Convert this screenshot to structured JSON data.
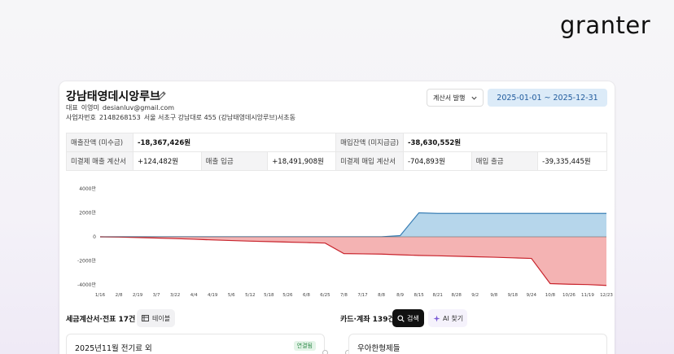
{
  "brand": {
    "logo_text": "granter"
  },
  "company": {
    "name": "강남태영데시앙루브",
    "representative_label": "대표",
    "representative": "이영미",
    "email": "desianluv@gmail.com",
    "biz_no_label": "사업자번호",
    "biz_no": "2148268153",
    "address": "서울 서초구 강남대로 455 (강남태영데시앙루브)서초동"
  },
  "toolbar": {
    "issue_label": "계산서 발행",
    "date_range": "2025-01-01 ~ 2025-12-31"
  },
  "summary": {
    "receivable_label": "매출잔액 (미수금)",
    "receivable_value": "-18,367,426원",
    "payable_label": "매입잔액 (미지급금)",
    "payable_value": "-38,630,552원",
    "unpaid_sales_invoice_label": "미결제 매출 계산서",
    "unpaid_sales_invoice_value": "+124,482원",
    "sales_deposit_label": "매출 입금",
    "sales_deposit_value": "+18,491,908원",
    "unpaid_purchase_invoice_label": "미결제 매입 계산서",
    "unpaid_purchase_invoice_value": "-704,893원",
    "purchase_withdrawal_label": "매입 출금",
    "purchase_withdrawal_value": "-39,335,445원"
  },
  "chart_data": {
    "type": "area",
    "ylim": [
      -4000,
      4000
    ],
    "y_ticks": [
      "4000만",
      "2000만",
      "0",
      "-2000만",
      "-4000만"
    ],
    "y_tick_values": [
      4000,
      2000,
      0,
      -2000,
      -4000
    ],
    "x_ticks": [
      "1/16",
      "2/8",
      "2/19",
      "3/7",
      "3/22",
      "4/4",
      "4/19",
      "5/6",
      "5/12",
      "5/18",
      "5/26",
      "6/8",
      "6/25",
      "7/8",
      "7/17",
      "8/8",
      "8/9",
      "8/15",
      "8/21",
      "8/28",
      "9/2",
      "9/8",
      "9/18",
      "9/24",
      "10/8",
      "10/26",
      "11/19",
      "12/23"
    ],
    "series": [
      {
        "color": "#a9cfe8",
        "line_color": "#3a7fb5",
        "values": [
          0,
          0,
          0,
          0,
          0,
          0,
          0,
          0,
          0,
          0,
          0,
          0,
          0,
          0,
          0,
          0,
          100,
          2000,
          1950,
          1950,
          1950,
          1950,
          1950,
          1950,
          1950,
          1950,
          1950,
          1950
        ]
      },
      {
        "color": "#f2a6a6",
        "line_color": "#c8232c",
        "values": [
          0,
          -20,
          -60,
          -100,
          -150,
          -200,
          -260,
          -310,
          -360,
          -400,
          -440,
          -480,
          -520,
          -1400,
          -1420,
          -1440,
          -1500,
          -1550,
          -1580,
          -1620,
          -1660,
          -1700,
          -1750,
          -1800,
          -3900,
          -3950,
          -3980,
          -4050
        ]
      }
    ]
  },
  "sections": {
    "left_title": "세금계산서·전표 17건",
    "table_btn_label": "테이블",
    "right_title": "카드·계좌 139건",
    "search_btn_label": "검색",
    "ai_btn_label": "AI 찾기"
  },
  "items": {
    "left_item_title": "2025년11월 전기료 외",
    "left_item_badge": "연결됨",
    "right_item_title": "우아한형제들"
  }
}
